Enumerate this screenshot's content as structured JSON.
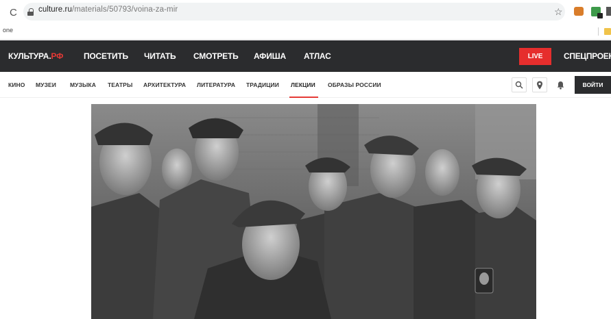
{
  "browser": {
    "url_host": "culture.ru",
    "url_path": "/materials/50793/voina-za-mir",
    "bookmark_item": "one"
  },
  "header": {
    "logo_main": "КУЛЬТУРА.",
    "logo_accent": "РФ",
    "nav": [
      "ПОСЕТИТЬ",
      "ЧИТАТЬ",
      "СМОТРЕТЬ",
      "АФИША",
      "АТЛАС"
    ],
    "live_label": "LIVE",
    "special_label": "СПЕЦПРОЕКТЫ"
  },
  "subnav": {
    "items": [
      "КИНО",
      "МУЗЕИ",
      "МУЗЫКА",
      "ТЕАТРЫ",
      "АРХИТЕКТУРА",
      "ЛИТЕРАТУРА",
      "ТРАДИЦИИ",
      "ЛЕКЦИИ",
      "ОБРАЗЫ РОССИИ"
    ],
    "active": "ЛЕКЦИИ",
    "login_label": "ВОЙТИ"
  },
  "colors": {
    "header_bg": "#2b2c2e",
    "accent": "#e53935"
  },
  "icons": [
    "reload-icon",
    "lock-icon",
    "star-icon",
    "search-icon",
    "location-pin-icon",
    "bell-icon"
  ]
}
